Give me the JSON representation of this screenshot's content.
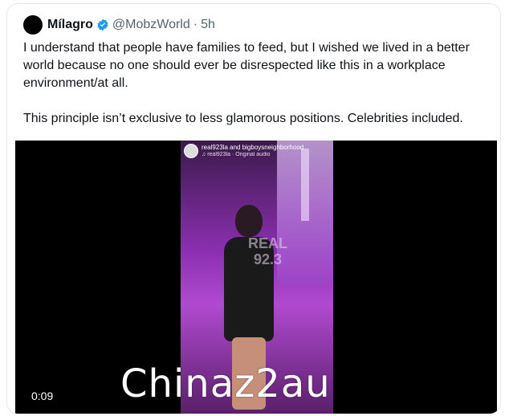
{
  "tweet": {
    "author_name": "Mílagro",
    "handle": "@MobzWorld",
    "separator": "·",
    "time": "5h",
    "paragraphs": [
      "I understand that people have families to feed, but I wished we lived in a better world because no one should ever be disrespected like this in a workplace environment/at all.",
      "This principle isn’t exclusive to less glamorous positions. Celebrities included."
    ]
  },
  "video": {
    "ig_username": "real923la and bigboysneighborhood",
    "ig_audio": "real923la · Original audio",
    "sign_text": "REAL\n92.3",
    "timecode": "0:09"
  },
  "watermark": "Chinaz2au",
  "colors": {
    "verified": "#1d9bf0",
    "text": "#0f1419",
    "muted": "#536471"
  },
  "icons": {
    "verified": "verified-badge-icon",
    "music": "music-note-icon"
  }
}
